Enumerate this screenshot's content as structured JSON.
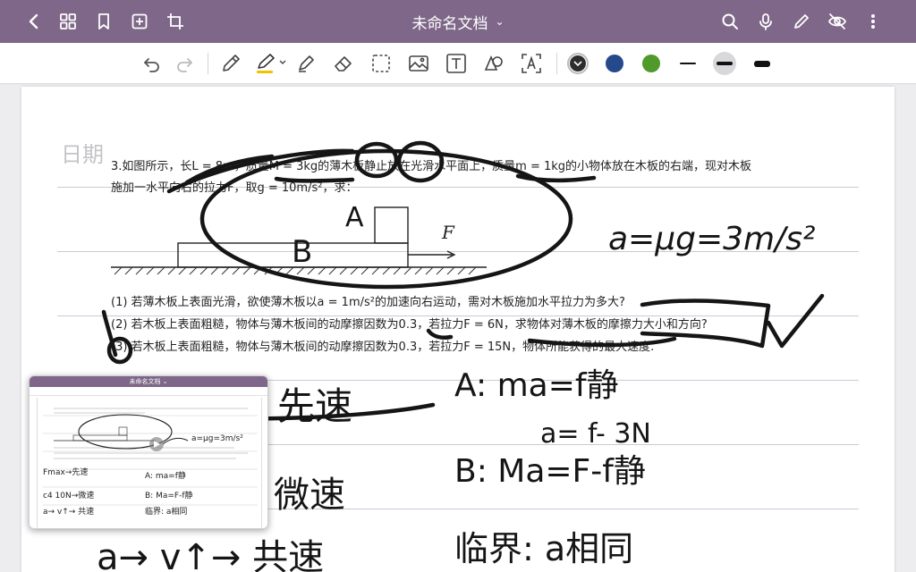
{
  "titlebar": {
    "title": "未命名文档",
    "icons": [
      "back-icon",
      "grid-icon",
      "bookmark-icon",
      "add-page-icon",
      "crop-icon",
      "search-icon",
      "microphone-icon",
      "pen-icon",
      "hide-icon",
      "more-icon"
    ]
  },
  "toolbar": {
    "tools": [
      "undo-icon",
      "redo-icon",
      "pencil-icon",
      "highlighter-icon",
      "marker-icon",
      "eraser-icon",
      "lasso-icon",
      "image-icon",
      "text-icon",
      "shape-icon",
      "ocr-icon"
    ],
    "colors": [
      "#2d2d2d",
      "#254a8c",
      "#4f9a2a"
    ],
    "highlighter_color": "#f2c200",
    "active_stroke_index": 1
  },
  "page": {
    "date_label": "日期",
    "question_line1": "3.如图所示，长L = 8m，质量M = 3kg的薄木板静止放在光滑水平面上，质量m = 1kg的小物体放在木板的右端，现对木板",
    "question_line2": "施加一水平向右的拉力F，取g = 10m/s²，求：",
    "label_A": "A",
    "label_B": "B",
    "label_F": "F",
    "sub1": "(1) 若薄木板上表面光滑，欲使薄木板以a = 1m/s²的加速向右运动，需对木板施加水平拉力为多大?",
    "sub2": "(2) 若木板上表面粗糙，物体与薄木板间的动摩擦因数为0.3，若拉力F = 6N，求物体对薄木板的摩擦力大小和方向?",
    "sub3": "(3) 若木板上表面粗糙，物体与薄木板间的动摩擦因数为0.3，若拉力F = 15N，物体所能获得的最大速度."
  },
  "notes": {
    "accel": "a=μg=3m/s²",
    "a_eq": "A: ma=f静",
    "a_sub": "a= f- 3N",
    "b_eq": "B: Ma=F-f静",
    "critical": "临界: a相同",
    "left1": "先速",
    "left2": "微速",
    "left3": "a→ v↑→ 共速"
  },
  "preview": {
    "title": "未命名文档 ⌄",
    "notes": [
      "Fmax→先速",
      "c4 10N→微速",
      "a→ v↑→ 共速",
      "A: ma=f静",
      "B: Ma=F-f静",
      "临界: a相同",
      "a=μg=3m/s²"
    ]
  }
}
